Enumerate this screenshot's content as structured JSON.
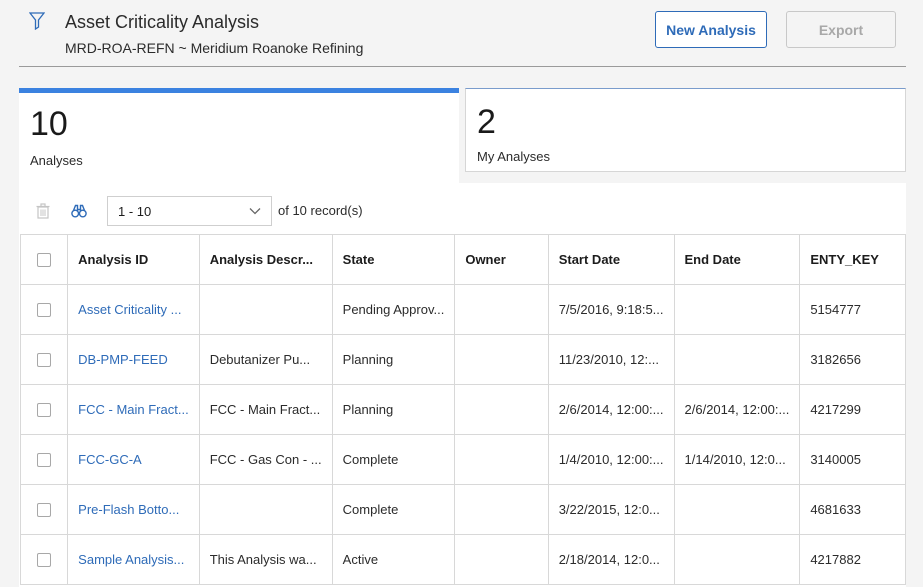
{
  "header": {
    "title": "Asset Criticality Analysis",
    "subtitle": "MRD-ROA-REFN ~ Meridium Roanoke Refining",
    "new_analysis_label": "New Analysis",
    "export_label": "Export"
  },
  "tabs": [
    {
      "count": "10",
      "label": "Analyses"
    },
    {
      "count": "2",
      "label": "My Analyses"
    }
  ],
  "toolbar": {
    "range": "1 - 10",
    "record_text": "of 10 record(s)"
  },
  "table": {
    "columns": [
      "Analysis ID",
      "Analysis Descr...",
      "State",
      "Owner",
      "Start Date",
      "End Date",
      "ENTY_KEY"
    ],
    "rows": [
      {
        "id": "Asset Criticality ...",
        "desc": "",
        "state": "Pending Approv...",
        "owner": "",
        "start": "7/5/2016, 9:18:5...",
        "end": "",
        "key": "5154777"
      },
      {
        "id": "DB-PMP-FEED",
        "desc": "Debutanizer Pu...",
        "state": "Planning",
        "owner": "",
        "start": "11/23/2010, 12:...",
        "end": "",
        "key": "3182656"
      },
      {
        "id": "FCC - Main Fract...",
        "desc": "FCC - Main Fract...",
        "state": "Planning",
        "owner": "",
        "start": "2/6/2014, 12:00:...",
        "end": "2/6/2014, 12:00:...",
        "key": "4217299"
      },
      {
        "id": "FCC-GC-A",
        "desc": "FCC - Gas Con - ...",
        "state": "Complete",
        "owner": "",
        "start": "1/4/2010, 12:00:...",
        "end": "1/14/2010, 12:0...",
        "key": "3140005"
      },
      {
        "id": "Pre-Flash Botto...",
        "desc": "",
        "state": "Complete",
        "owner": "",
        "start": "3/22/2015, 12:0...",
        "end": "",
        "key": "4681633"
      },
      {
        "id": "Sample Analysis...",
        "desc": "This Analysis wa...",
        "state": "Active",
        "owner": "",
        "start": "2/18/2014, 12:0...",
        "end": "",
        "key": "4217882"
      }
    ]
  },
  "colors": {
    "accent": "#3b82e0",
    "link": "#2e6bb8"
  },
  "icons": [
    "filter-icon",
    "trash-icon",
    "binoculars-icon",
    "chevron-down-icon"
  ]
}
